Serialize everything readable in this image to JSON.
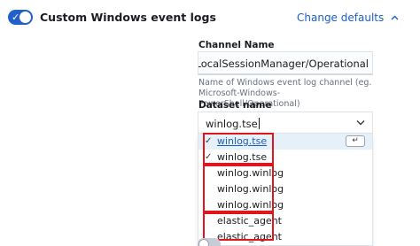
{
  "section": {
    "title": "Custom Windows event logs",
    "toggle_on": true,
    "change_defaults": "Change defaults"
  },
  "channel": {
    "label": "Channel Name",
    "value": "nalServices-LocalSessionManager/Operational",
    "help": "Name of Windows event log channel (eg. Microsoft-Windows-PowerShell/Operational)"
  },
  "dataset": {
    "label": "Dataset name",
    "value": "winlog.tse",
    "options": [
      {
        "label": "winlog.tse",
        "checked": true,
        "active": true,
        "link": true,
        "enter_hint": "↵"
      },
      {
        "label": "winlog.tse",
        "checked": true
      },
      {
        "label": "winlog.winlog"
      },
      {
        "label": "winlog.winlog"
      },
      {
        "label": "winlog.winlog"
      },
      {
        "label": "elastic_agent"
      },
      {
        "label": "elastic_agent"
      }
    ]
  },
  "colors": {
    "accent": "#2160c9",
    "link": "#1b5ec4",
    "highlight": "#e0161c",
    "active_row": "#e6f0f8"
  }
}
